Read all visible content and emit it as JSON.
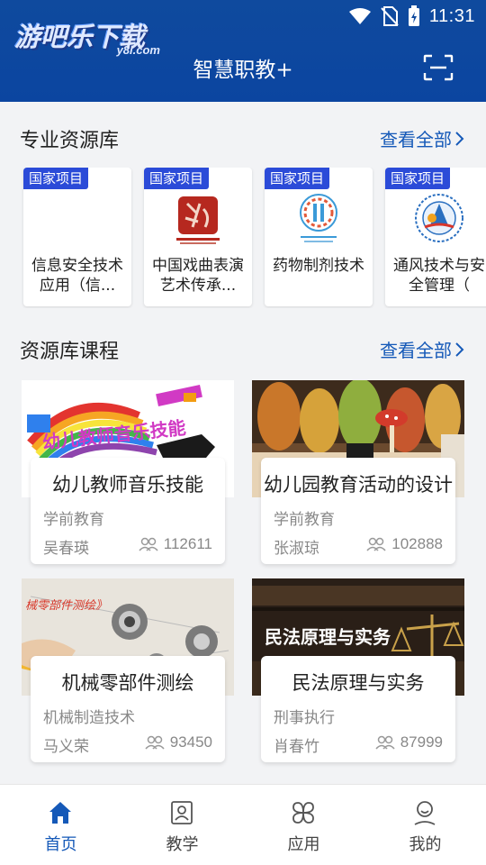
{
  "status_bar": {
    "time": "11:31"
  },
  "header": {
    "logo_main": "游吧乐下载",
    "logo_sub": "y8l.com",
    "title": "智慧职教+"
  },
  "resource_section": {
    "title": "专业资源库",
    "see_all": "查看全部",
    "items": [
      {
        "badge": "国家项目",
        "name": "信息安全技术应用（信..."
      },
      {
        "badge": "国家项目",
        "name": "中国戏曲表演艺术传承..."
      },
      {
        "badge": "国家项目",
        "name": "药物制剂技术"
      },
      {
        "badge": "国家项目",
        "name": "通风技术与安全管理（"
      }
    ]
  },
  "course_section": {
    "title": "资源库课程",
    "see_all": "查看全部",
    "courses": [
      {
        "title": "幼儿教师音乐技能",
        "category": "学前教育",
        "teacher": "吴春瑛",
        "views": "112611",
        "image_text": "幼儿教师音乐技能"
      },
      {
        "title": "幼儿园教育活动的设计",
        "category": "学前教育",
        "teacher": "张淑琼",
        "views": "102888",
        "image_text": ""
      },
      {
        "title": "机械零部件测绘",
        "category": "机械制造技术",
        "teacher": "马义荣",
        "views": "93450",
        "image_text": "械零部件测绘》"
      },
      {
        "title": "民法原理与实务",
        "category": "刑事执行",
        "teacher": "肖春竹",
        "views": "87999",
        "image_text": "民法原理与实务"
      }
    ]
  },
  "bottom_nav": [
    {
      "label": "首页",
      "icon": "home-icon",
      "active": true
    },
    {
      "label": "教学",
      "icon": "teaching-icon",
      "active": false
    },
    {
      "label": "应用",
      "icon": "apps-icon",
      "active": false
    },
    {
      "label": "我的",
      "icon": "profile-icon",
      "active": false
    }
  ],
  "colors": {
    "header": "#0f4a9e",
    "accent": "#1559b8",
    "badge": "#2b4bd8"
  }
}
